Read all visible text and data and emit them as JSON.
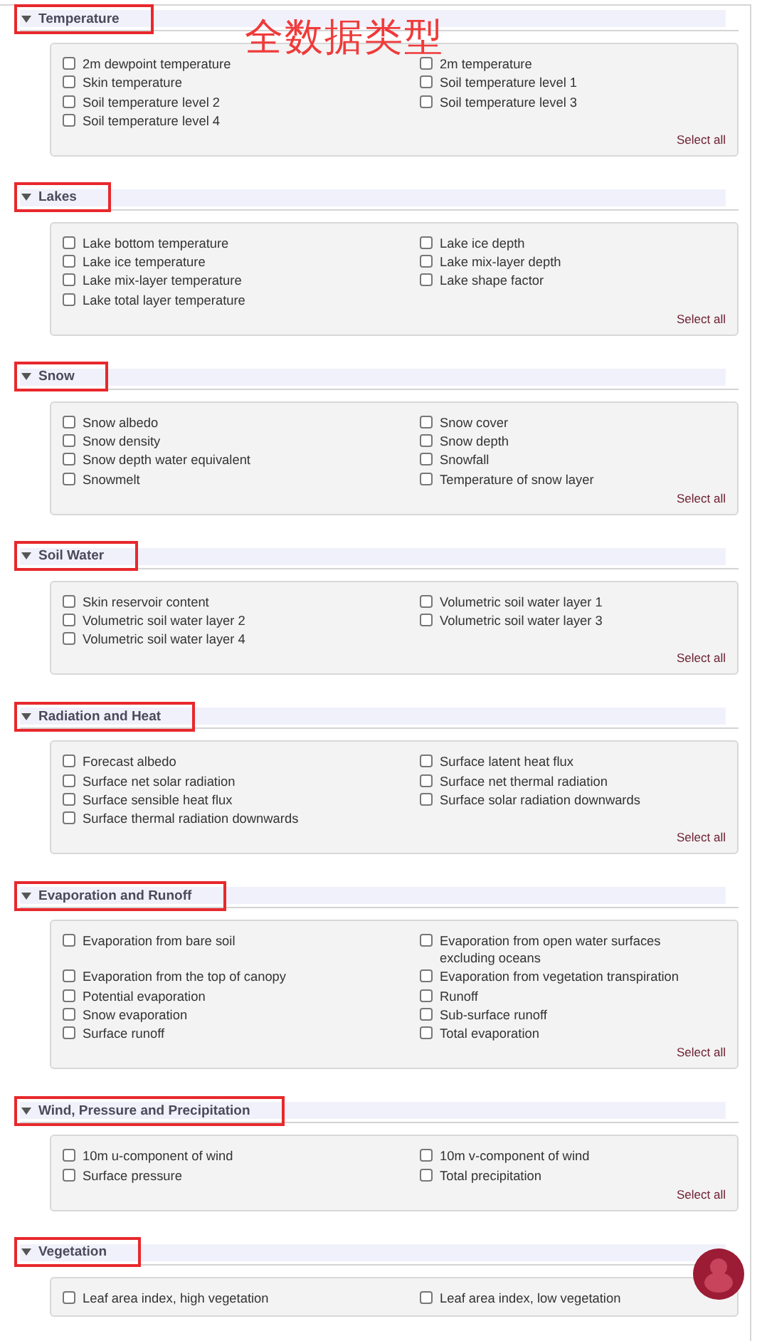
{
  "annotation": {
    "text": "全数据类型"
  },
  "sections": [
    {
      "title": "Temperature",
      "expanded": true,
      "highlighted": true,
      "select_all": "Select all",
      "items": [
        {
          "label": "2m dewpoint temperature",
          "checked": false
        },
        {
          "label": "2m temperature",
          "checked": false
        },
        {
          "label": "Skin temperature",
          "checked": false
        },
        {
          "label": "Soil temperature level 1",
          "checked": false
        },
        {
          "label": "Soil temperature level 2",
          "checked": false
        },
        {
          "label": "Soil temperature level 3",
          "checked": false
        },
        {
          "label": "Soil temperature level 4",
          "checked": false
        }
      ]
    },
    {
      "title": "Lakes",
      "expanded": true,
      "highlighted": true,
      "select_all": "Select all",
      "items": [
        {
          "label": "Lake bottom temperature",
          "checked": false
        },
        {
          "label": "Lake ice depth",
          "checked": false
        },
        {
          "label": "Lake ice temperature",
          "checked": false
        },
        {
          "label": "Lake mix-layer depth",
          "checked": false
        },
        {
          "label": "Lake mix-layer temperature",
          "checked": false
        },
        {
          "label": "Lake shape factor",
          "checked": false
        },
        {
          "label": "Lake total layer temperature",
          "checked": false
        }
      ]
    },
    {
      "title": "Snow",
      "expanded": true,
      "highlighted": true,
      "select_all": "Select all",
      "items": [
        {
          "label": "Snow albedo",
          "checked": false
        },
        {
          "label": "Snow cover",
          "checked": false
        },
        {
          "label": "Snow density",
          "checked": false
        },
        {
          "label": "Snow depth",
          "checked": false
        },
        {
          "label": "Snow depth water equivalent",
          "checked": false
        },
        {
          "label": "Snowfall",
          "checked": false
        },
        {
          "label": "Snowmelt",
          "checked": false
        },
        {
          "label": "Temperature of snow layer",
          "checked": false
        }
      ]
    },
    {
      "title": "Soil Water",
      "expanded": true,
      "highlighted": true,
      "select_all": "Select all",
      "items": [
        {
          "label": "Skin reservoir content",
          "checked": false
        },
        {
          "label": "Volumetric soil water layer 1",
          "checked": false
        },
        {
          "label": "Volumetric soil water layer 2",
          "checked": false
        },
        {
          "label": "Volumetric soil water layer 3",
          "checked": false
        },
        {
          "label": "Volumetric soil water layer 4",
          "checked": false
        }
      ]
    },
    {
      "title": "Radiation and Heat",
      "expanded": true,
      "highlighted": true,
      "select_all": "Select all",
      "items": [
        {
          "label": "Forecast albedo",
          "checked": false
        },
        {
          "label": "Surface latent heat flux",
          "checked": false
        },
        {
          "label": "Surface net solar radiation",
          "checked": false
        },
        {
          "label": "Surface net thermal radiation",
          "checked": false
        },
        {
          "label": "Surface sensible heat flux",
          "checked": false
        },
        {
          "label": "Surface solar radiation downwards",
          "checked": false
        },
        {
          "label": "Surface thermal radiation downwards",
          "checked": false
        }
      ]
    },
    {
      "title": "Evaporation and Runoff",
      "expanded": true,
      "highlighted": true,
      "select_all": "Select all",
      "items": [
        {
          "label": "Evaporation from bare soil",
          "checked": false
        },
        {
          "label": "Evaporation from open water surfaces excluding oceans",
          "checked": false
        },
        {
          "label": "Evaporation from the top of canopy",
          "checked": false
        },
        {
          "label": "Evaporation from vegetation transpiration",
          "checked": false
        },
        {
          "label": "Potential evaporation",
          "checked": false
        },
        {
          "label": "Runoff",
          "checked": false
        },
        {
          "label": "Snow evaporation",
          "checked": false
        },
        {
          "label": "Sub-surface runoff",
          "checked": false
        },
        {
          "label": "Surface runoff",
          "checked": false
        },
        {
          "label": "Total evaporation",
          "checked": false
        }
      ]
    },
    {
      "title": "Wind, Pressure and Precipitation",
      "expanded": true,
      "highlighted": true,
      "select_all": "Select all",
      "items": [
        {
          "label": "10m u-component of wind",
          "checked": false
        },
        {
          "label": "10m v-component of wind",
          "checked": false
        },
        {
          "label": "Surface pressure",
          "checked": false
        },
        {
          "label": "Total precipitation",
          "checked": false
        }
      ]
    },
    {
      "title": "Vegetation",
      "expanded": true,
      "highlighted": true,
      "items": [
        {
          "label": "Leaf area index, high vegetation",
          "checked": false
        },
        {
          "label": "Leaf area index, low vegetation",
          "checked": false
        }
      ]
    }
  ]
}
